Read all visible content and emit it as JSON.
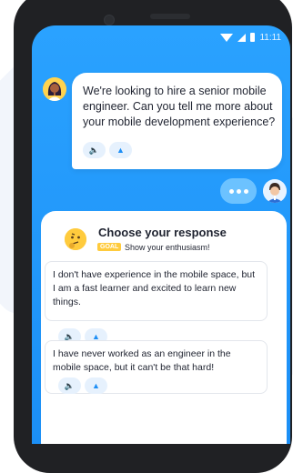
{
  "status_bar": {
    "time": "11:11"
  },
  "message": {
    "text": "We're looking to hire a senior mobile engineer. Can you tell me more about your mobile development experience?"
  },
  "response_card": {
    "title": "Choose your response",
    "goal_badge": "GOAL",
    "goal_text": "Show your enthusiasm!",
    "options": [
      {
        "text": "I don't have experience in the mobile space, but I am a fast learner and excited to learn new things."
      },
      {
        "text": "I have never worked as an engineer in the mobile space, but it can't be that hard!"
      }
    ]
  },
  "colors": {
    "screen_blue": "#1b8ff6",
    "accent_blue": "#1d8ef5",
    "goal_yellow": "#ffcb3d"
  }
}
